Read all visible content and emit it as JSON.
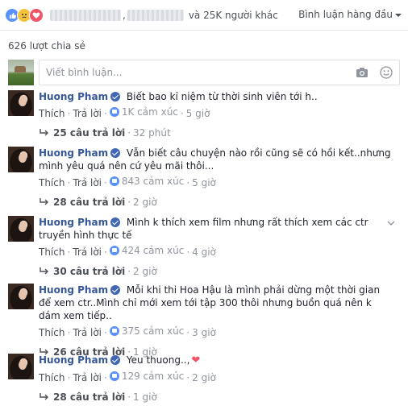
{
  "header": {
    "others_text": "và 25K người khác",
    "sort_label": "Bình luận hàng đầu",
    "reaction_icons": [
      "like-icon",
      "sad-icon",
      "love-icon"
    ]
  },
  "shares_text": "626 lượt chia sẻ",
  "composer": {
    "placeholder": "Viết bình luận...",
    "camera_icon": "camera-icon",
    "emoji_icon": "smiley-icon"
  },
  "comments": [
    {
      "author": "Huong Pham",
      "text": "Biết bao kỉ niệm từ thời sinh viên tới h..",
      "like_label": "Thích",
      "reply_label": "Trả lời",
      "reactions": "1K cảm xúc",
      "time": "5 giờ",
      "replies_label": "25 câu trả lời",
      "replies_time": "32 phút"
    },
    {
      "author": "Huong Pham",
      "text": "Vẫn biết câu chuyện nào rồi cũng sẽ có hồi kết..nhưng mình yêu quá nên cứ yêu mãi thôi...",
      "like_label": "Thích",
      "reply_label": "Trả lời",
      "reactions": "843 cảm xúc",
      "time": "5 giờ",
      "replies_label": "28 câu trả lời",
      "replies_time": "2 giờ"
    },
    {
      "author": "Huong Pham",
      "text": "Mình k thích xem film nhưng rất thích xem các ctr truyền hình thực tế",
      "like_label": "Thích",
      "reply_label": "Trả lời",
      "reactions": "424 cảm xúc",
      "time": "4 giờ",
      "replies_label": "30 câu trả lời",
      "replies_time": "2 giờ"
    },
    {
      "author": "Huong Pham",
      "text": "Mỗi khi thi Hoa Hậu là mình phải dừng một thời gian để xem ctr..Mình chỉ mới xem tới tập 300 thôi nhưng buồn quá nên k dám xem tiếp..",
      "like_label": "Thích",
      "reply_label": "Trả lời",
      "reactions": "375 cảm xúc",
      "time": "3 giờ",
      "replies_label": "26 câu trả lời",
      "replies_time": "1 giờ"
    },
    {
      "author": "Huong Pham",
      "text": "Yeu thuong..,",
      "like_label": "Thích",
      "reply_label": "Trả lời",
      "reactions": "129 cảm xúc",
      "time": "2 giờ",
      "replies_label": "28 câu trả lời",
      "replies_time": "1 giờ"
    }
  ],
  "colors": {
    "link_blue": "#365899",
    "verified_blue": "#4267b2",
    "meta_grey": "#90949c",
    "like_blue": "#5890ff",
    "love_red": "#f25268"
  }
}
